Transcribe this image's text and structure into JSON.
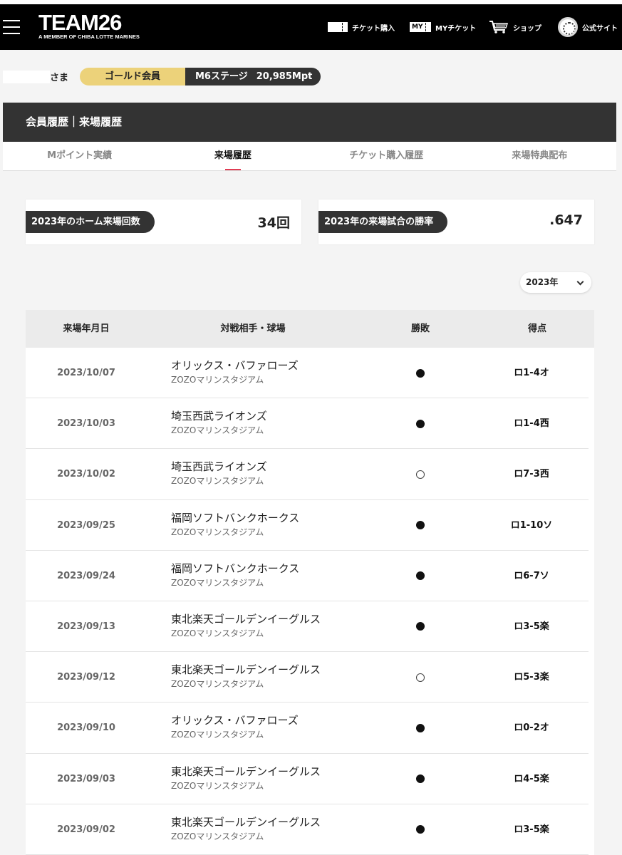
{
  "header": {
    "logo_main": "TEAM26",
    "logo_sub": "A MEMBER OF CHIBA LOTTE MARINES",
    "nav": [
      {
        "icon": "ticket-icon",
        "label": "チケット購入"
      },
      {
        "icon": "my-ticket-icon",
        "label": "MYチケット",
        "icon_text": "MY"
      },
      {
        "icon": "cart-icon",
        "label": "ショップ"
      },
      {
        "icon": "emblem-icon",
        "label": "公式サイト"
      }
    ]
  },
  "member": {
    "honorific": "さま",
    "rank": "ゴールド会員",
    "stage": "M6ステージ",
    "points": "20,985Mpt"
  },
  "section": {
    "title": "会員履歴｜来場履歴"
  },
  "tabs": [
    {
      "label": "Mポイント実績",
      "active": false
    },
    {
      "label": "来場履歴",
      "active": true
    },
    {
      "label": "チケット購入履歴",
      "active": false
    },
    {
      "label": "来場特典配布",
      "active": false
    }
  ],
  "stats": {
    "home_visits_label": "2023年のホーム来場回数",
    "home_visits_value": "34回",
    "win_rate_label": "2023年の来場試合の勝率",
    "win_rate_value": ".647"
  },
  "year_select": {
    "value": "2023年"
  },
  "table": {
    "headers": [
      "来場年月日",
      "対戦相手・球場",
      "勝敗",
      "得点"
    ],
    "rows": [
      {
        "date": "2023/10/07",
        "opponent": "オリックス・バファローズ",
        "venue": "ZOZOマリンスタジアム",
        "result": "loss",
        "score": "ロ1-4オ"
      },
      {
        "date": "2023/10/03",
        "opponent": "埼玉西武ライオンズ",
        "venue": "ZOZOマリンスタジアム",
        "result": "loss",
        "score": "ロ1-4西"
      },
      {
        "date": "2023/10/02",
        "opponent": "埼玉西武ライオンズ",
        "venue": "ZOZOマリンスタジアム",
        "result": "win",
        "score": "ロ7-3西"
      },
      {
        "date": "2023/09/25",
        "opponent": "福岡ソフトバンクホークス",
        "venue": "ZOZOマリンスタジアム",
        "result": "loss",
        "score": "ロ1-10ソ"
      },
      {
        "date": "2023/09/24",
        "opponent": "福岡ソフトバンクホークス",
        "venue": "ZOZOマリンスタジアム",
        "result": "loss",
        "score": "ロ6-7ソ"
      },
      {
        "date": "2023/09/13",
        "opponent": "東北楽天ゴールデンイーグルス",
        "venue": "ZOZOマリンスタジアム",
        "result": "loss",
        "score": "ロ3-5楽"
      },
      {
        "date": "2023/09/12",
        "opponent": "東北楽天ゴールデンイーグルス",
        "venue": "ZOZOマリンスタジアム",
        "result": "win",
        "score": "ロ5-3楽"
      },
      {
        "date": "2023/09/10",
        "opponent": "オリックス・バファローズ",
        "venue": "ZOZOマリンスタジアム",
        "result": "loss",
        "score": "ロ0-2オ"
      },
      {
        "date": "2023/09/03",
        "opponent": "東北楽天ゴールデンイーグルス",
        "venue": "ZOZOマリンスタジアム",
        "result": "loss",
        "score": "ロ4-5楽"
      },
      {
        "date": "2023/09/02",
        "opponent": "東北楽天ゴールデンイーグルス",
        "venue": "ZOZOマリンスタジアム",
        "result": "loss",
        "score": "ロ3-5楽"
      }
    ]
  }
}
